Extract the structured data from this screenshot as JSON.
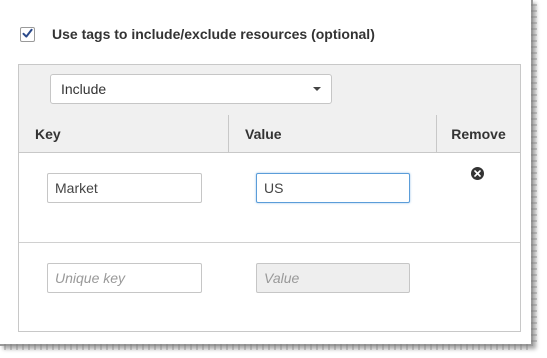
{
  "checkbox": {
    "label": "Use tags to include/exclude resources (optional)",
    "checked": true
  },
  "mode_select": {
    "selected": "Include"
  },
  "table": {
    "headers": [
      "Key",
      "Value",
      "Remove"
    ],
    "rows": [
      {
        "key": "Market",
        "value": "US"
      }
    ],
    "new_row": {
      "key_placeholder": "Unique key",
      "value_placeholder": "Value"
    }
  },
  "icons": {
    "checkbox": "check-icon",
    "remove": "remove-circle-icon",
    "select": "chevron-down-icon"
  },
  "colors": {
    "focus_border": "#5b9dd9",
    "panel_header_bg": "#f0f0f0"
  }
}
